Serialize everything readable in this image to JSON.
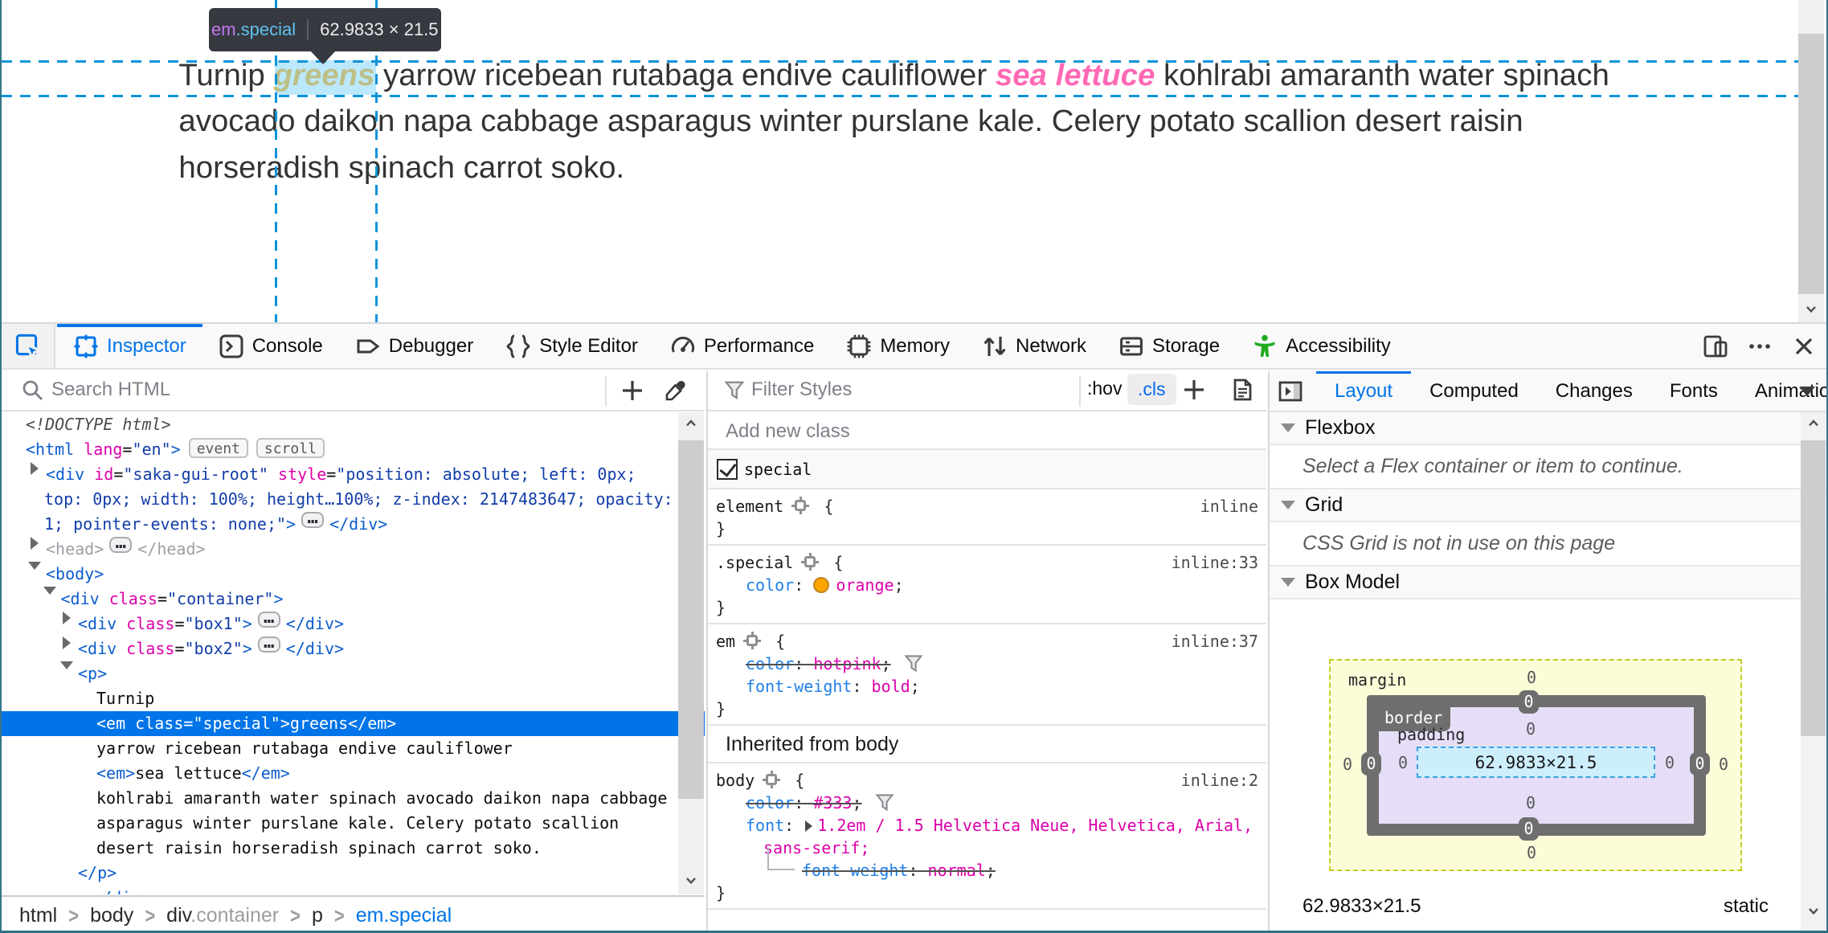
{
  "window": {
    "border_color": "#35758c"
  },
  "page": {
    "paragraph": {
      "line1_pre": "Turnip ",
      "line1_em_special": "greens",
      "line1_mid": " yarrow ricebean rutabaga endive cauliflower ",
      "line1_em": "sea lettuce",
      "line1_post": " kohlrabi amaranth water spinach",
      "line2": "avocado daikon napa cabbage asparagus winter purslane kale. Celery potato scallion desert raisin",
      "line3": "horseradish spinach carrot soko."
    },
    "text_color": "#333333",
    "em_special_color": "orange",
    "em_color": "hotpink"
  },
  "infobar": {
    "tag": "em",
    "class": ".special",
    "dims": "62.9833 × 21.5"
  },
  "toolbar": {
    "tabs": [
      {
        "label": "Inspector",
        "icon": "inspector-icon",
        "active": true
      },
      {
        "label": "Console",
        "icon": "console-icon",
        "active": false
      },
      {
        "label": "Debugger",
        "icon": "debugger-icon",
        "active": false
      },
      {
        "label": "Style Editor",
        "icon": "style-editor-icon",
        "active": false
      },
      {
        "label": "Performance",
        "icon": "performance-icon",
        "active": false
      },
      {
        "label": "Memory",
        "icon": "memory-icon",
        "active": false
      },
      {
        "label": "Network",
        "icon": "network-icon",
        "active": false
      },
      {
        "label": "Storage",
        "icon": "storage-icon",
        "active": false
      },
      {
        "label": "Accessibility",
        "icon": "accessibility-icon",
        "active": false
      }
    ],
    "accessibility_color": "#1faa1f",
    "accent": "#0074e8"
  },
  "markup": {
    "search_placeholder": "Search HTML",
    "rows": [
      {
        "indent": 15,
        "segs": [
          {
            "k": "doct",
            "t": "<!DOCTYPE html>"
          }
        ]
      },
      {
        "indent": 15,
        "segs": [
          {
            "k": "tag",
            "t": "<html "
          },
          {
            "k": "attr",
            "t": "lang"
          },
          {
            "k": "punc",
            "t": "="
          },
          {
            "k": "val",
            "t": "\"en\""
          },
          {
            "k": "tag",
            "t": ">"
          },
          {
            "k": "badge",
            "t": "event"
          },
          {
            "k": "badge",
            "t": "scroll"
          }
        ]
      },
      {
        "indent": 27.5,
        "segs": [
          {
            "k": "arrow-right"
          },
          {
            "k": "tag",
            "t": "<div "
          },
          {
            "k": "attr",
            "t": "id"
          },
          {
            "k": "punc",
            "t": "="
          },
          {
            "k": "val",
            "t": "\"saka-gui-root\""
          },
          {
            "k": "tag",
            "t": " "
          },
          {
            "k": "attr",
            "t": "style"
          },
          {
            "k": "punc",
            "t": "="
          },
          {
            "k": "val",
            "t": "\"position: absolute; left: 0px;"
          }
        ]
      },
      {
        "indent": 26.5,
        "segs": [
          {
            "k": "val",
            "t": "top: 0px; width: 100%; height…100%; z-index: 2147483647; opacity:"
          }
        ]
      },
      {
        "indent": 26.5,
        "segs": [
          {
            "k": "val",
            "t": "1; pointer-events: none;\""
          },
          {
            "k": "tag",
            "t": ">"
          },
          {
            "k": "ell",
            "t": "…"
          },
          {
            "k": "tag",
            "t": "</div>"
          }
        ]
      },
      {
        "indent": 27.5,
        "segs": [
          {
            "k": "arrow-right"
          },
          {
            "k": "dim",
            "t": "<head>"
          },
          {
            "k": "ell",
            "t": "…"
          },
          {
            "k": "dim",
            "t": "</head>"
          }
        ]
      },
      {
        "indent": 27.5,
        "segs": [
          {
            "k": "arrow-down"
          },
          {
            "k": "tag",
            "t": "<body>"
          }
        ]
      },
      {
        "indent": 36.75,
        "segs": [
          {
            "k": "arrow-down"
          },
          {
            "k": "tag",
            "t": "<div "
          },
          {
            "k": "attr",
            "t": "class"
          },
          {
            "k": "punc",
            "t": "="
          },
          {
            "k": "val",
            "t": "\"container\""
          },
          {
            "k": "tag",
            "t": ">"
          }
        ]
      },
      {
        "indent": 47.5,
        "segs": [
          {
            "k": "arrow-right"
          },
          {
            "k": "tag",
            "t": "<div "
          },
          {
            "k": "attr",
            "t": "class"
          },
          {
            "k": "punc",
            "t": "="
          },
          {
            "k": "val",
            "t": "\"box1\""
          },
          {
            "k": "tag",
            "t": ">"
          },
          {
            "k": "ell",
            "t": "…"
          },
          {
            "k": "tag",
            "t": "</div>"
          }
        ]
      },
      {
        "indent": 47.5,
        "segs": [
          {
            "k": "arrow-right"
          },
          {
            "k": "tag",
            "t": "<div "
          },
          {
            "k": "attr",
            "t": "class"
          },
          {
            "k": "punc",
            "t": "="
          },
          {
            "k": "val",
            "t": "\"box2\""
          },
          {
            "k": "tag",
            "t": ">"
          },
          {
            "k": "ell",
            "t": "…"
          },
          {
            "k": "tag",
            "t": "</div>"
          }
        ]
      },
      {
        "indent": 47.5,
        "segs": [
          {
            "k": "arrow-down"
          },
          {
            "k": "tag",
            "t": "<p>"
          }
        ]
      },
      {
        "indent": 59,
        "segs": [
          {
            "k": "text",
            "t": "Turnip"
          }
        ]
      },
      {
        "indent": 59,
        "cls": "selected",
        "segs": [
          {
            "k": "tag",
            "t": "<em "
          },
          {
            "k": "attr",
            "t": "class"
          },
          {
            "k": "punc",
            "t": "="
          },
          {
            "k": "val",
            "t": "\"special\""
          },
          {
            "k": "tag",
            "t": ">"
          },
          {
            "k": "text",
            "t": "greens"
          },
          {
            "k": "tag",
            "t": "</em>"
          }
        ]
      },
      {
        "indent": 59,
        "segs": [
          {
            "k": "text",
            "t": "yarrow ricebean rutabaga endive cauliflower"
          }
        ]
      },
      {
        "indent": 59,
        "segs": [
          {
            "k": "tag",
            "t": "<em>"
          },
          {
            "k": "text",
            "t": "sea lettuce"
          },
          {
            "k": "tag",
            "t": "</em>"
          }
        ]
      },
      {
        "indent": 59,
        "segs": [
          {
            "k": "text",
            "t": "kohlrabi amaranth water spinach avocado daikon napa cabbage"
          }
        ]
      },
      {
        "indent": 59,
        "segs": [
          {
            "k": "text",
            "t": "asparagus winter purslane kale. Celery potato scallion"
          }
        ]
      },
      {
        "indent": 59,
        "segs": [
          {
            "k": "text",
            "t": "desert raisin horseradish spinach carrot soko."
          }
        ]
      },
      {
        "indent": 47.5,
        "segs": [
          {
            "k": "tag",
            "t": "</p>"
          }
        ]
      },
      {
        "indent": 56.5,
        "segs": [
          {
            "k": "tag",
            "t": "</div>"
          }
        ]
      }
    ]
  },
  "breadcrumb": {
    "items": [
      {
        "label": "html",
        "suffix": ""
      },
      {
        "label": "body",
        "suffix": ""
      },
      {
        "label": "div",
        "suffix": ".container"
      },
      {
        "label": "p",
        "suffix": ""
      },
      {
        "label": "em.special",
        "suffix": "",
        "selected": true
      }
    ]
  },
  "rules": {
    "filter_placeholder": "Filter Styles",
    "hov_label": ":hov",
    "cls_label": ".cls",
    "add_class_placeholder": "Add new class",
    "class_toggle_label": "special",
    "inherited_header": "Inherited from body",
    "blocks_a": [
      {
        "lines": [
          {
            "cls": "",
            "loc": "inline",
            "segs": [
              {
                "k": "sel",
                "t": "element"
              },
              {
                "k": "target"
              },
              {
                "k": "rpunc",
                "t": " {"
              }
            ]
          },
          {
            "cls": "",
            "segs": [
              {
                "k": "rpunc",
                "t": "}"
              }
            ]
          }
        ]
      },
      {
        "lines": [
          {
            "cls": "",
            "loc": "inline:33",
            "segs": [
              {
                "k": "sel",
                "t": ".special"
              },
              {
                "k": "target"
              },
              {
                "k": "rpunc",
                "t": " {"
              }
            ]
          },
          {
            "cls": "decl",
            "segs": [
              {
                "k": "prop",
                "t": "color"
              },
              {
                "k": "rpunc",
                "t": ": "
              },
              {
                "k": "swatch"
              },
              {
                "k": "rval",
                "t": "orange"
              },
              {
                "k": "rpunc",
                "t": ";"
              }
            ]
          },
          {
            "cls": "",
            "segs": [
              {
                "k": "rpunc",
                "t": "}"
              }
            ]
          }
        ]
      },
      {
        "lines": [
          {
            "cls": "",
            "loc": "inline:37",
            "segs": [
              {
                "k": "sel",
                "t": "em"
              },
              {
                "k": "target"
              },
              {
                "k": "rpunc",
                "t": " {"
              }
            ]
          },
          {
            "cls": "decl",
            "segs": [
              {
                "k": "prop strike",
                "t": "color"
              },
              {
                "k": "rpunc strike",
                "t": ": "
              },
              {
                "k": "rval strike",
                "t": "hotpink"
              },
              {
                "k": "rpunc strike",
                "t": ";"
              },
              {
                "k": "funnel"
              }
            ]
          },
          {
            "cls": "decl",
            "segs": [
              {
                "k": "prop",
                "t": "font-weight"
              },
              {
                "k": "rpunc",
                "t": ": "
              },
              {
                "k": "rval",
                "t": "bold"
              },
              {
                "k": "rpunc",
                "t": ";"
              }
            ]
          },
          {
            "cls": "",
            "segs": [
              {
                "k": "rpunc",
                "t": "}"
              }
            ]
          }
        ]
      }
    ],
    "blocks_b": [
      {
        "lines": [
          {
            "cls": "",
            "loc": "inline:2",
            "segs": [
              {
                "k": "sel",
                "t": "body"
              },
              {
                "k": "target"
              },
              {
                "k": "rpunc",
                "t": " {"
              }
            ]
          },
          {
            "cls": "decl",
            "segs": [
              {
                "k": "prop strike",
                "t": "color"
              },
              {
                "k": "rpunc strike",
                "t": ": "
              },
              {
                "k": "rval strike",
                "t": "#333"
              },
              {
                "k": "rpunc strike",
                "t": ";"
              },
              {
                "k": "funnel"
              }
            ]
          },
          {
            "cls": "decl",
            "segs": [
              {
                "k": "prop",
                "t": "font"
              },
              {
                "k": "rpunc",
                "t": ": "
              },
              {
                "k": "expand"
              },
              {
                "k": "rval",
                "t": "1.2em / 1.5 Helvetica Neue, Helvetica, Arial,"
              }
            ]
          },
          {
            "cls": "declwrap",
            "segs": [
              {
                "k": "rval",
                "t": "sans-serif;"
              }
            ]
          },
          {
            "cls": "declsub",
            "segs": [
              {
                "k": "treeline"
              },
              {
                "k": "prop strike",
                "t": "font-weight"
              },
              {
                "k": "rpunc strike",
                "t": ": "
              },
              {
                "k": "rval strike",
                "t": "normal"
              },
              {
                "k": "rpunc strike",
                "t": ";"
              }
            ]
          },
          {
            "cls": "",
            "segs": [
              {
                "k": "rpunc",
                "t": "}"
              }
            ]
          }
        ]
      }
    ]
  },
  "layout_panel": {
    "tabs": [
      {
        "label": "Layout",
        "active": true
      },
      {
        "label": "Computed",
        "active": false
      },
      {
        "label": "Changes",
        "active": false
      },
      {
        "label": "Fonts",
        "active": false
      },
      {
        "label": "Animations",
        "active": false
      }
    ],
    "sections": {
      "flexbox_title": "Flexbox",
      "flexbox_note": "Select a Flex container or item to continue.",
      "grid_title": "Grid",
      "grid_note": "CSS Grid is not in use on this page",
      "boxmodel_title": "Box Model"
    },
    "boxmodel": {
      "margin_label": "margin",
      "border_label": "border",
      "padding_label": "padding",
      "content_dims": "62.9833×21.5",
      "margin_top": "0",
      "margin_right": "0",
      "margin_bottom": "0",
      "margin_left": "0",
      "border_top": "0",
      "border_right": "0",
      "border_bottom": "0",
      "border_left": "0",
      "padding_top": "0",
      "padding_right": "0",
      "padding_bottom": "0",
      "padding_left": "0",
      "summary_dims": "62.9833×21.5",
      "summary_position": "static"
    }
  }
}
